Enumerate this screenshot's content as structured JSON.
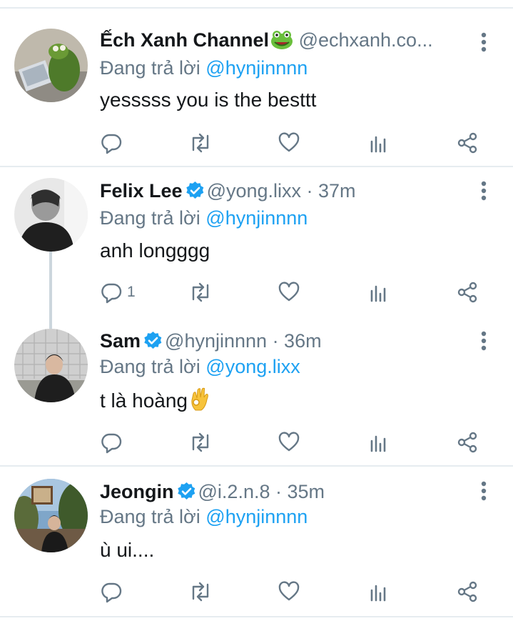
{
  "tweets": [
    {
      "name": "Ếch Xanh Channel",
      "handle": "@echxanh.co...",
      "time": "",
      "verified": false,
      "emoji": "frog-face",
      "reply_prefix": "Đang trả lời",
      "reply_to": "@hynjinnnn",
      "text": "yesssss you is the besttt",
      "reply_count": ""
    },
    {
      "name": "Felix Lee",
      "handle": "@yong.lixx",
      "time": " · 37m",
      "verified": true,
      "reply_prefix": "Đang trả lời",
      "reply_to": "@hynjinnnn",
      "text": "anh longggg",
      "reply_count": "1"
    },
    {
      "name": "Sam",
      "handle": "@hynjinnnn",
      "time": " · 36m",
      "verified": true,
      "reply_prefix": "Đang trả lời",
      "reply_to": "@yong.lixx",
      "text": "t là hoàng",
      "emoji": "ok-hand",
      "reply_count": ""
    },
    {
      "name": "Jeongin",
      "handle": "@i.2.n.8",
      "time": " · 35m",
      "verified": true,
      "reply_prefix": "Đang trả lời",
      "reply_to": "@hynjinnnn",
      "text": "ù ui....",
      "reply_count": ""
    }
  ],
  "icons": {
    "reply": "reply-icon",
    "retweet": "retweet-icon",
    "like": "heart-icon",
    "stats": "stats-icon",
    "share": "share-icon",
    "more": "more-vertical-icon"
  },
  "colors": {
    "link": "#1da1f2",
    "secondary_text": "#657786",
    "verified": "#1da1f2",
    "separator": "#e6ecf0"
  }
}
